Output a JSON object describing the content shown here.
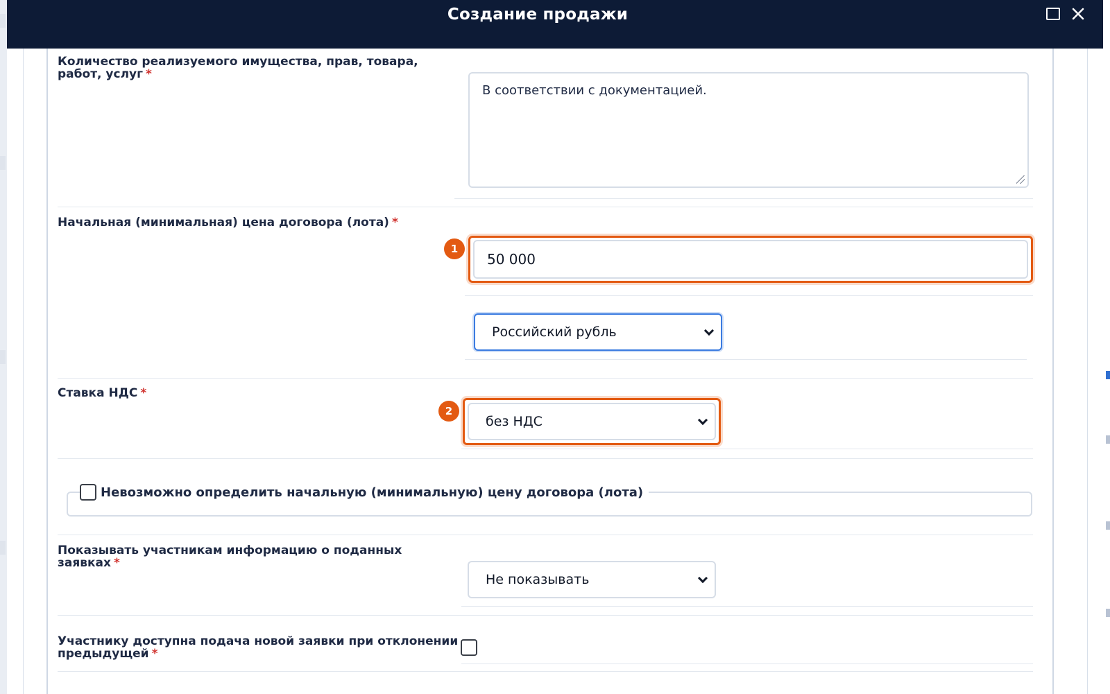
{
  "modal": {
    "title": "Создание продажи"
  },
  "fields": {
    "quantity": {
      "label": "Количество реализуемого имущества, прав, товара, работ, услуг",
      "required_mark": "*",
      "value": "В соответствии с документацией."
    },
    "start_price": {
      "label": "Начальная (минимальная) цена договора (лота)",
      "required_mark": "*",
      "value": "50 000",
      "currency": "Российский рубль"
    },
    "vat": {
      "label": "Ставка НДС",
      "required_mark": "*",
      "value": "без НДС"
    },
    "price_undefined": {
      "label": "Невозможно определить начальную (минимальную) цену договора (лота)",
      "checked": false
    },
    "show_bids_info": {
      "label": "Показывать участникам информацию о поданных заявках",
      "required_mark": "*",
      "value": "Не показывать"
    },
    "resubmit_allowed": {
      "label": "Участнику доступна подача новой заявки при отклонении предыдущей",
      "required_mark": "*",
      "checked": false
    }
  },
  "annotations": {
    "badge_1": "1",
    "badge_2": "2"
  },
  "colors": {
    "header_bg": "#0d1b36",
    "highlight": "#e35a12",
    "required": "#d0312d",
    "focus": "#3b7be0"
  }
}
